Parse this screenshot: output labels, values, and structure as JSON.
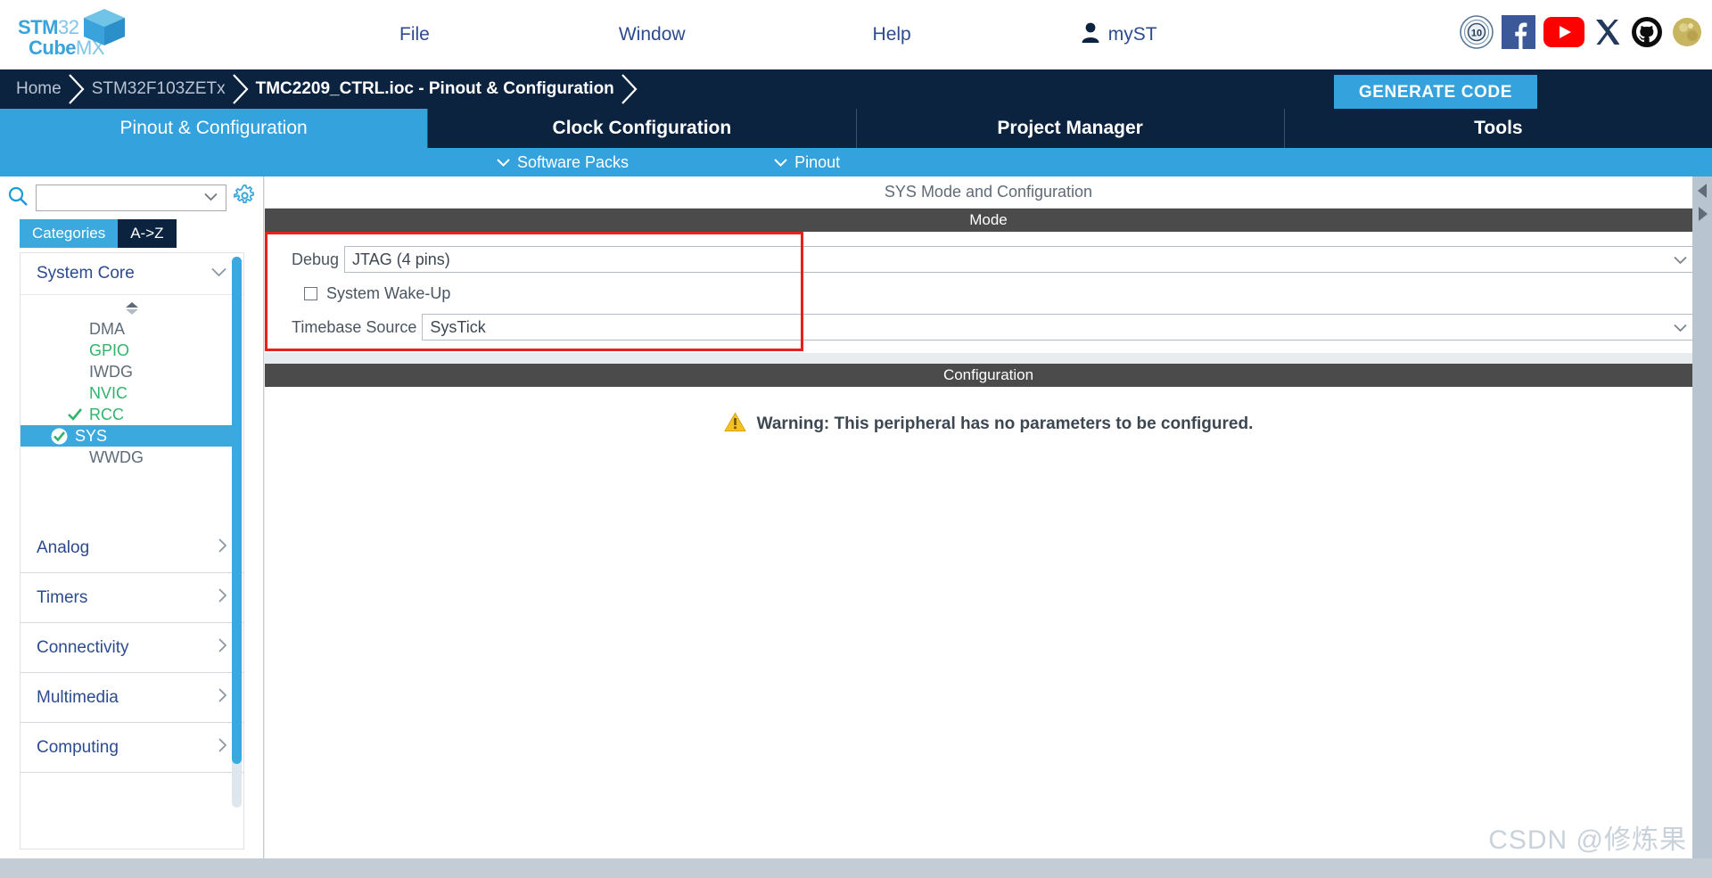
{
  "app": {
    "logo": {
      "line1_bold": "STM",
      "line1_light": "32",
      "line2_bold": "Cube",
      "line2_light": "MX"
    },
    "watermark": "CSDN @修炼果"
  },
  "menubar": {
    "items": [
      {
        "label": "File",
        "name": "menu-file"
      },
      {
        "label": "Window",
        "name": "menu-window"
      },
      {
        "label": "Help",
        "name": "menu-help"
      }
    ],
    "account": {
      "label": "myST",
      "icon": "user-icon"
    },
    "social": [
      {
        "name": "ten-years-badge-icon",
        "label": "10"
      },
      {
        "name": "facebook-icon",
        "label": "f"
      },
      {
        "name": "youtube-icon",
        "label": "▶"
      },
      {
        "name": "x-twitter-icon",
        "label": "X"
      },
      {
        "name": "github-icon",
        "label": ""
      },
      {
        "name": "wikipedia-icon",
        "label": ""
      }
    ]
  },
  "breadcrumb": {
    "items": [
      {
        "label": "Home",
        "active": false
      },
      {
        "label": "STM32F103ZETx",
        "active": false
      },
      {
        "label": "TMC2209_CTRL.ioc - Pinout & Configuration",
        "active": true
      }
    ],
    "generate_code_label": "GENERATE CODE"
  },
  "tabs": [
    {
      "label": "Pinout & Configuration",
      "active": true
    },
    {
      "label": "Clock Configuration",
      "active": false
    },
    {
      "label": "Project Manager",
      "active": false
    },
    {
      "label": "Tools",
      "active": false
    }
  ],
  "subbar": [
    {
      "label": "Software Packs",
      "icon": "chevron-down-icon"
    },
    {
      "label": "Pinout",
      "icon": "chevron-down-icon"
    }
  ],
  "sidebar": {
    "search": {
      "value": "",
      "placeholder": ""
    },
    "search_icon": "search-icon",
    "settings_icon": "gear-icon",
    "view_tabs": [
      {
        "label": "Categories",
        "selected": true
      },
      {
        "label": "A->Z",
        "selected": false
      }
    ],
    "group": {
      "label": "System Core",
      "icon": "chevron-down-icon"
    },
    "peripherals": [
      {
        "label": "DMA",
        "state": "gray",
        "check": "none"
      },
      {
        "label": "GPIO",
        "state": "green",
        "check": "none"
      },
      {
        "label": "IWDG",
        "state": "gray",
        "check": "none"
      },
      {
        "label": "NVIC",
        "state": "green",
        "check": "none"
      },
      {
        "label": "RCC",
        "state": "green",
        "check": "tick"
      },
      {
        "label": "SYS",
        "state": "selected",
        "check": "tick-circle"
      },
      {
        "label": "WWDG",
        "state": "gray",
        "check": "none"
      }
    ],
    "categories": [
      {
        "label": "Analog",
        "icon": "chevron-right-icon"
      },
      {
        "label": "Timers",
        "icon": "chevron-right-icon"
      },
      {
        "label": "Connectivity",
        "icon": "chevron-right-icon"
      },
      {
        "label": "Multimedia",
        "icon": "chevron-right-icon"
      },
      {
        "label": "Computing",
        "icon": "chevron-right-icon"
      }
    ]
  },
  "content": {
    "panel_title": "SYS Mode and Configuration",
    "mode_header": "Mode",
    "mode": {
      "debug_label": "Debug",
      "debug_value": "JTAG (4 pins)",
      "wakeup_label": "System Wake-Up",
      "wakeup_checked": false,
      "timebase_label": "Timebase Source",
      "timebase_value": "SysTick"
    },
    "configuration_header": "Configuration",
    "warning": {
      "icon": "warning-triangle-icon",
      "text": "Warning: This peripheral has no parameters to be configured."
    }
  },
  "colors": {
    "brand_blue": "#33a2dd",
    "navy": "#0c2340",
    "green": "#31b46a",
    "section_gray": "#4b4b4b",
    "highlight_red": "#e8211c",
    "warning_yellow": "#f5c024"
  }
}
